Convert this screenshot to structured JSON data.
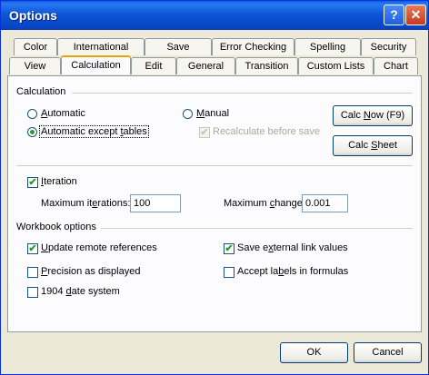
{
  "window": {
    "title": "Options",
    "help_glyph": "?",
    "close_glyph": "✕"
  },
  "tabs": {
    "top_row": [
      "Color",
      "International",
      "Save",
      "Error Checking",
      "Spelling",
      "Security"
    ],
    "bottom_row": [
      "View",
      "Calculation",
      "Edit",
      "General",
      "Transition",
      "Custom Lists",
      "Chart"
    ],
    "active": "Calculation"
  },
  "calculation": {
    "group_label": "Calculation",
    "automatic": {
      "pre": "",
      "key": "A",
      "post": "utomatic",
      "selected": false
    },
    "auto_except_tables": {
      "pre": "Automatic except ",
      "key": "t",
      "post": "ables",
      "selected": true
    },
    "manual": {
      "pre": "",
      "key": "M",
      "post": "anual",
      "selected": false
    },
    "recalc_before_save": {
      "label": "Recalculate before save",
      "checked": true,
      "disabled": true
    },
    "calc_now_button": {
      "pre": "Calc ",
      "key": "N",
      "post": "ow (F9)"
    },
    "calc_sheet_button": {
      "pre": "Calc ",
      "key": "S",
      "post": "heet"
    },
    "iteration": {
      "pre": "",
      "key": "I",
      "post": "teration",
      "checked": true
    },
    "max_iterations": {
      "pre": "Maximum it",
      "key": "e",
      "post": "rations:",
      "value": "100"
    },
    "max_change": {
      "pre": "Maximum ",
      "key": "c",
      "post": "hange:",
      "value": "0.001"
    }
  },
  "workbook": {
    "group_label": "Workbook options",
    "update_remote": {
      "pre": "",
      "key": "U",
      "post": "pdate remote references",
      "checked": true
    },
    "precision_displayed": {
      "pre": "",
      "key": "P",
      "post": "recision as displayed",
      "checked": false
    },
    "date_1904": {
      "pre": "1904 ",
      "key": "d",
      "post": "ate system",
      "checked": false
    },
    "save_external": {
      "pre": "Save e",
      "key": "x",
      "post": "ternal link values",
      "checked": true
    },
    "accept_labels": {
      "pre": "Accept la",
      "key": "b",
      "post": "els in formulas",
      "checked": false
    }
  },
  "footer": {
    "ok_label": "OK",
    "cancel_label": "Cancel"
  },
  "check_glyph": "✔"
}
